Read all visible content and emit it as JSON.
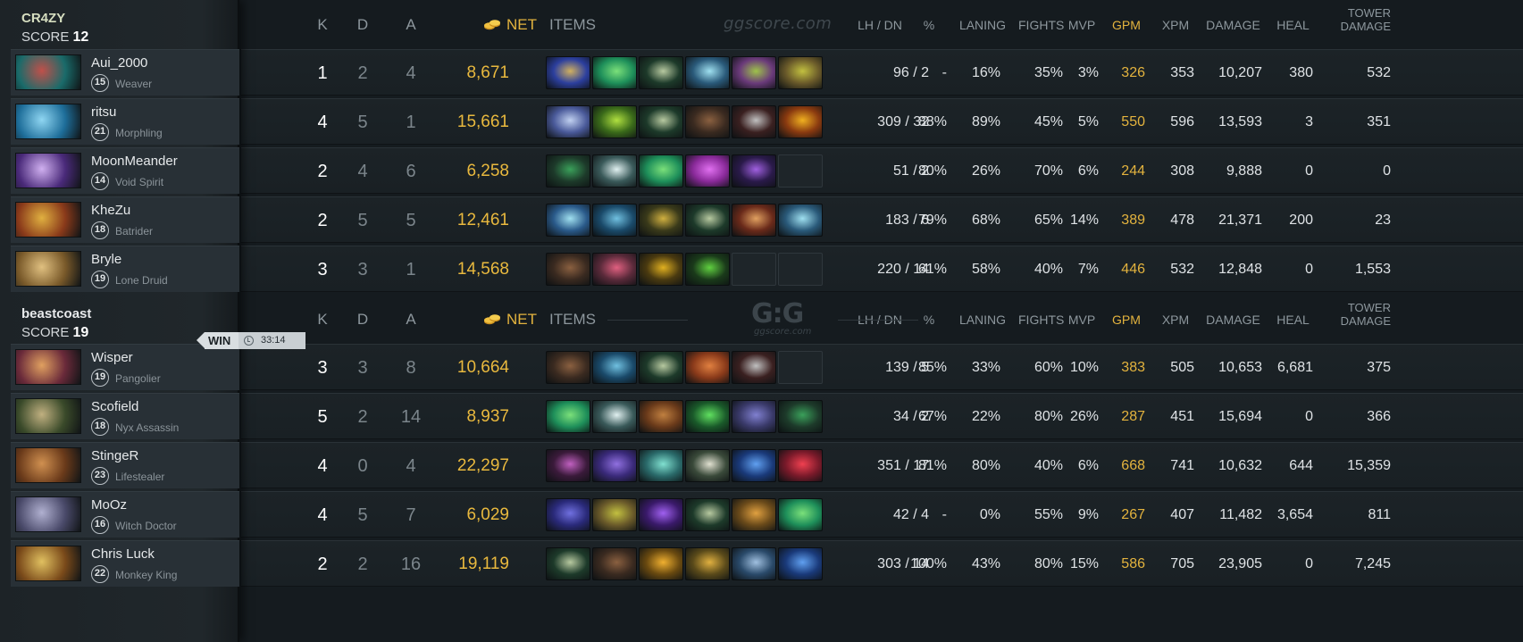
{
  "teams": [
    {
      "name": "CR4ZY",
      "score_label": "SCORE",
      "score": "12",
      "players": [
        {
          "name": "Aui_2000",
          "level": "15",
          "hero": "Weaver",
          "k": "1",
          "d": "2",
          "a": "4",
          "net": "8,671",
          "lh_dn": "96  /  2",
          "pct": "-",
          "laning": "16%",
          "fights": "35%",
          "mvp": "3%",
          "gpm": "326",
          "xpm": "353",
          "damage": "10,207",
          "heal": "380",
          "tower": "532",
          "portrait": [
            "#1a6b6a",
            "#c0504a"
          ],
          "items": [
            [
              "#2c3f9e",
              "#d0b060"
            ],
            [
              "#1e8f5a",
              "#7be07a"
            ],
            [
              "#1d3a2a",
              "#b7c9a0"
            ],
            [
              "#2a5a7a",
              "#9fe0f0"
            ],
            [
              "#6a3a7a",
              "#9ec24a"
            ],
            [
              "#6a5a2a",
              "#c2c040"
            ]
          ]
        },
        {
          "name": "ritsu",
          "level": "21",
          "hero": "Morphling",
          "k": "4",
          "d": "5",
          "a": "1",
          "net": "15,661",
          "lh_dn": "309  /  32",
          "pct": "88%",
          "laning": "89%",
          "fights": "45%",
          "mvp": "5%",
          "gpm": "550",
          "xpm": "596",
          "damage": "13,593",
          "heal": "3",
          "tower": "351",
          "portrait": [
            "#1e6e9a",
            "#8fd6f2"
          ],
          "items": [
            [
              "#4a5a9a",
              "#c0d0f0"
            ],
            [
              "#3a6a1a",
              "#b0e040"
            ],
            [
              "#1d3a2a",
              "#b7c9a0"
            ],
            [
              "#3a2a20",
              "#8a6040"
            ],
            [
              "#3a2020",
              "#c0c0c0"
            ],
            [
              "#8a3a10",
              "#f0b020"
            ]
          ]
        },
        {
          "name": "MoonMeander",
          "level": "14",
          "hero": "Void Spirit",
          "k": "2",
          "d": "4",
          "a": "6",
          "net": "6,258",
          "lh_dn": "51  /  2",
          "pct": "80%",
          "laning": "26%",
          "fights": "70%",
          "mvp": "6%",
          "gpm": "244",
          "xpm": "308",
          "damage": "9,888",
          "heal": "0",
          "tower": "0",
          "portrait": [
            "#4a2a7a",
            "#d0b0f0"
          ],
          "items": [
            [
              "#1d3a2a",
              "#3aa05a"
            ],
            [
              "#3a5a5a",
              "#e0f0f0"
            ],
            [
              "#1e8f5a",
              "#7be07a"
            ],
            [
              "#8a2a9a",
              "#e070f0"
            ],
            [
              "#2a1a4a",
              "#a060e0"
            ],
            [
              "empty"
            ]
          ]
        },
        {
          "name": "KheZu",
          "level": "18",
          "hero": "Batrider",
          "k": "2",
          "d": "5",
          "a": "5",
          "net": "12,461",
          "lh_dn": "183  /  6",
          "pct": "79%",
          "laning": "68%",
          "fights": "65%",
          "mvp": "14%",
          "gpm": "389",
          "xpm": "478",
          "damage": "21,371",
          "heal": "200",
          "tower": "23",
          "portrait": [
            "#8a3a1a",
            "#e0b040"
          ],
          "items": [
            [
              "#2a5a8a",
              "#a0e0f0"
            ],
            [
              "#1a4a6a",
              "#70c0e0"
            ],
            [
              "#3a3a1a",
              "#d0b040"
            ],
            [
              "#1d3a2a",
              "#b7c9a0"
            ],
            [
              "#6a2a1a",
              "#e0a060"
            ],
            [
              "#2a5a7a",
              "#9fe0f0"
            ]
          ]
        },
        {
          "name": "Bryle",
          "level": "19",
          "hero": "Lone Druid",
          "k": "3",
          "d": "3",
          "a": "1",
          "net": "14,568",
          "lh_dn": "220  /  14",
          "pct": "61%",
          "laning": "58%",
          "fights": "40%",
          "mvp": "7%",
          "gpm": "446",
          "xpm": "532",
          "damage": "12,848",
          "heal": "0",
          "tower": "1,553",
          "portrait": [
            "#7a5a2a",
            "#e0c080"
          ],
          "items": [
            [
              "#3a2a20",
              "#8a6040"
            ],
            [
              "#5a2a3a",
              "#e06080"
            ],
            [
              "#4a3a10",
              "#e0b020"
            ],
            [
              "#1a3a1a",
              "#60d040"
            ],
            [
              "empty"
            ],
            [
              "empty"
            ]
          ]
        }
      ]
    },
    {
      "name": "beastcoast",
      "score_label": "SCORE",
      "score": "19",
      "players": [
        {
          "name": "Wisper",
          "level": "19",
          "hero": "Pangolier",
          "k": "3",
          "d": "3",
          "a": "8",
          "net": "10,664",
          "lh_dn": "139  /  5",
          "pct": "85%",
          "laning": "33%",
          "fights": "60%",
          "mvp": "10%",
          "gpm": "383",
          "xpm": "505",
          "damage": "10,653",
          "heal": "6,681",
          "tower": "375",
          "portrait": [
            "#6a2a3a",
            "#e0a060"
          ],
          "items": [
            [
              "#3a2a20",
              "#8a6040"
            ],
            [
              "#1a4a6a",
              "#70c0e0"
            ],
            [
              "#1d3a2a",
              "#b7c9a0"
            ],
            [
              "#8a3a1a",
              "#e08040"
            ],
            [
              "#3a2020",
              "#c0c0c0"
            ],
            [
              "empty"
            ]
          ]
        },
        {
          "name": "Scofield",
          "level": "18",
          "hero": "Nyx Assassin",
          "k": "5",
          "d": "2",
          "a": "14",
          "net": "8,937",
          "lh_dn": "34  /  2",
          "pct": "67%",
          "laning": "22%",
          "fights": "80%",
          "mvp": "26%",
          "gpm": "287",
          "xpm": "451",
          "damage": "15,694",
          "heal": "0",
          "tower": "366",
          "portrait": [
            "#3a4a2a",
            "#c0b080"
          ],
          "items": [
            [
              "#1e8f5a",
              "#7be07a"
            ],
            [
              "#3a5a5a",
              "#e0f0f0"
            ],
            [
              "#6a3a1a",
              "#c08040"
            ],
            [
              "#1a5a2a",
              "#60e060"
            ],
            [
              "#3a3a6a",
              "#8080d0"
            ],
            [
              "#1d3a2a",
              "#3aa05a"
            ]
          ]
        },
        {
          "name": "StingeR",
          "level": "23",
          "hero": "Lifestealer",
          "k": "4",
          "d": "0",
          "a": "4",
          "net": "22,297",
          "lh_dn": "351  /  17",
          "pct": "81%",
          "laning": "80%",
          "fights": "40%",
          "mvp": "6%",
          "gpm": "668",
          "xpm": "741",
          "damage": "10,632",
          "heal": "644",
          "tower": "15,359",
          "portrait": [
            "#6a3a1a",
            "#d09050"
          ],
          "items": [
            [
              "#3a1a3a",
              "#c060c0"
            ],
            [
              "#3a2a7a",
              "#9070e0"
            ],
            [
              "#2a6a6a",
              "#80e0d0"
            ],
            [
              "#3a4a3a",
              "#e0e0d0"
            ],
            [
              "#1a3a7a",
              "#60a0f0"
            ],
            [
              "#7a1a2a",
              "#f04050"
            ]
          ]
        },
        {
          "name": "MoOz",
          "level": "16",
          "hero": "Witch Doctor",
          "k": "4",
          "d": "5",
          "a": "7",
          "net": "6,029",
          "lh_dn": "42  /  4",
          "pct": "-",
          "laning": "0%",
          "fights": "55%",
          "mvp": "9%",
          "gpm": "267",
          "xpm": "407",
          "damage": "11,482",
          "heal": "3,654",
          "tower": "811",
          "portrait": [
            "#4a4a6a",
            "#b0b0d0"
          ],
          "items": [
            [
              "#2a2a7a",
              "#7070e0"
            ],
            [
              "#6a5a2a",
              "#c2c040"
            ],
            [
              "#3a1a6a",
              "#a060f0"
            ],
            [
              "#1d3a2a",
              "#b7c9a0"
            ],
            [
              "#6a4a1a",
              "#e0a040"
            ],
            [
              "#1e8f5a",
              "#7be07a"
            ]
          ]
        },
        {
          "name": "Chris Luck",
          "level": "22",
          "hero": "Monkey King",
          "k": "2",
          "d": "2",
          "a": "16",
          "net": "19,119",
          "lh_dn": "303  /  14",
          "pct": "100%",
          "laning": "43%",
          "fights": "80%",
          "mvp": "15%",
          "gpm": "586",
          "xpm": "705",
          "damage": "23,905",
          "heal": "0",
          "tower": "7,245",
          "portrait": [
            "#7a4a1a",
            "#e0c060"
          ],
          "items": [
            [
              "#1d3a2a",
              "#b7c9a0"
            ],
            [
              "#3a2a20",
              "#8a6040"
            ],
            [
              "#6a4a10",
              "#f0b030"
            ],
            [
              "#5a4a1a",
              "#e0b040"
            ],
            [
              "#2a4a6a",
              "#a0c0e0"
            ],
            [
              "#1a3a7a",
              "#60a0f0"
            ]
          ]
        }
      ]
    }
  ],
  "headers": {
    "k": "K",
    "d": "D",
    "a": "A",
    "net": "NET",
    "items": "ITEMS",
    "lh_dn": "LH  /  DN",
    "pct": "%",
    "laning": "LANING",
    "fights": "FIGHTS",
    "mvp": "MVP",
    "gpm": "GPM",
    "xpm": "XPM",
    "damage": "DAMAGE",
    "heal": "HEAL",
    "tower_1": "TOWER",
    "tower_2": "DAMAGE"
  },
  "watermark": "ggscore.com",
  "logo": {
    "text": "G:G",
    "sub": "ggscore.com"
  },
  "result": {
    "label": "WIN",
    "time": "33:14"
  },
  "colors": {
    "gold": "#e3b33e",
    "background": "#151b1f",
    "row": "#1c2327"
  }
}
